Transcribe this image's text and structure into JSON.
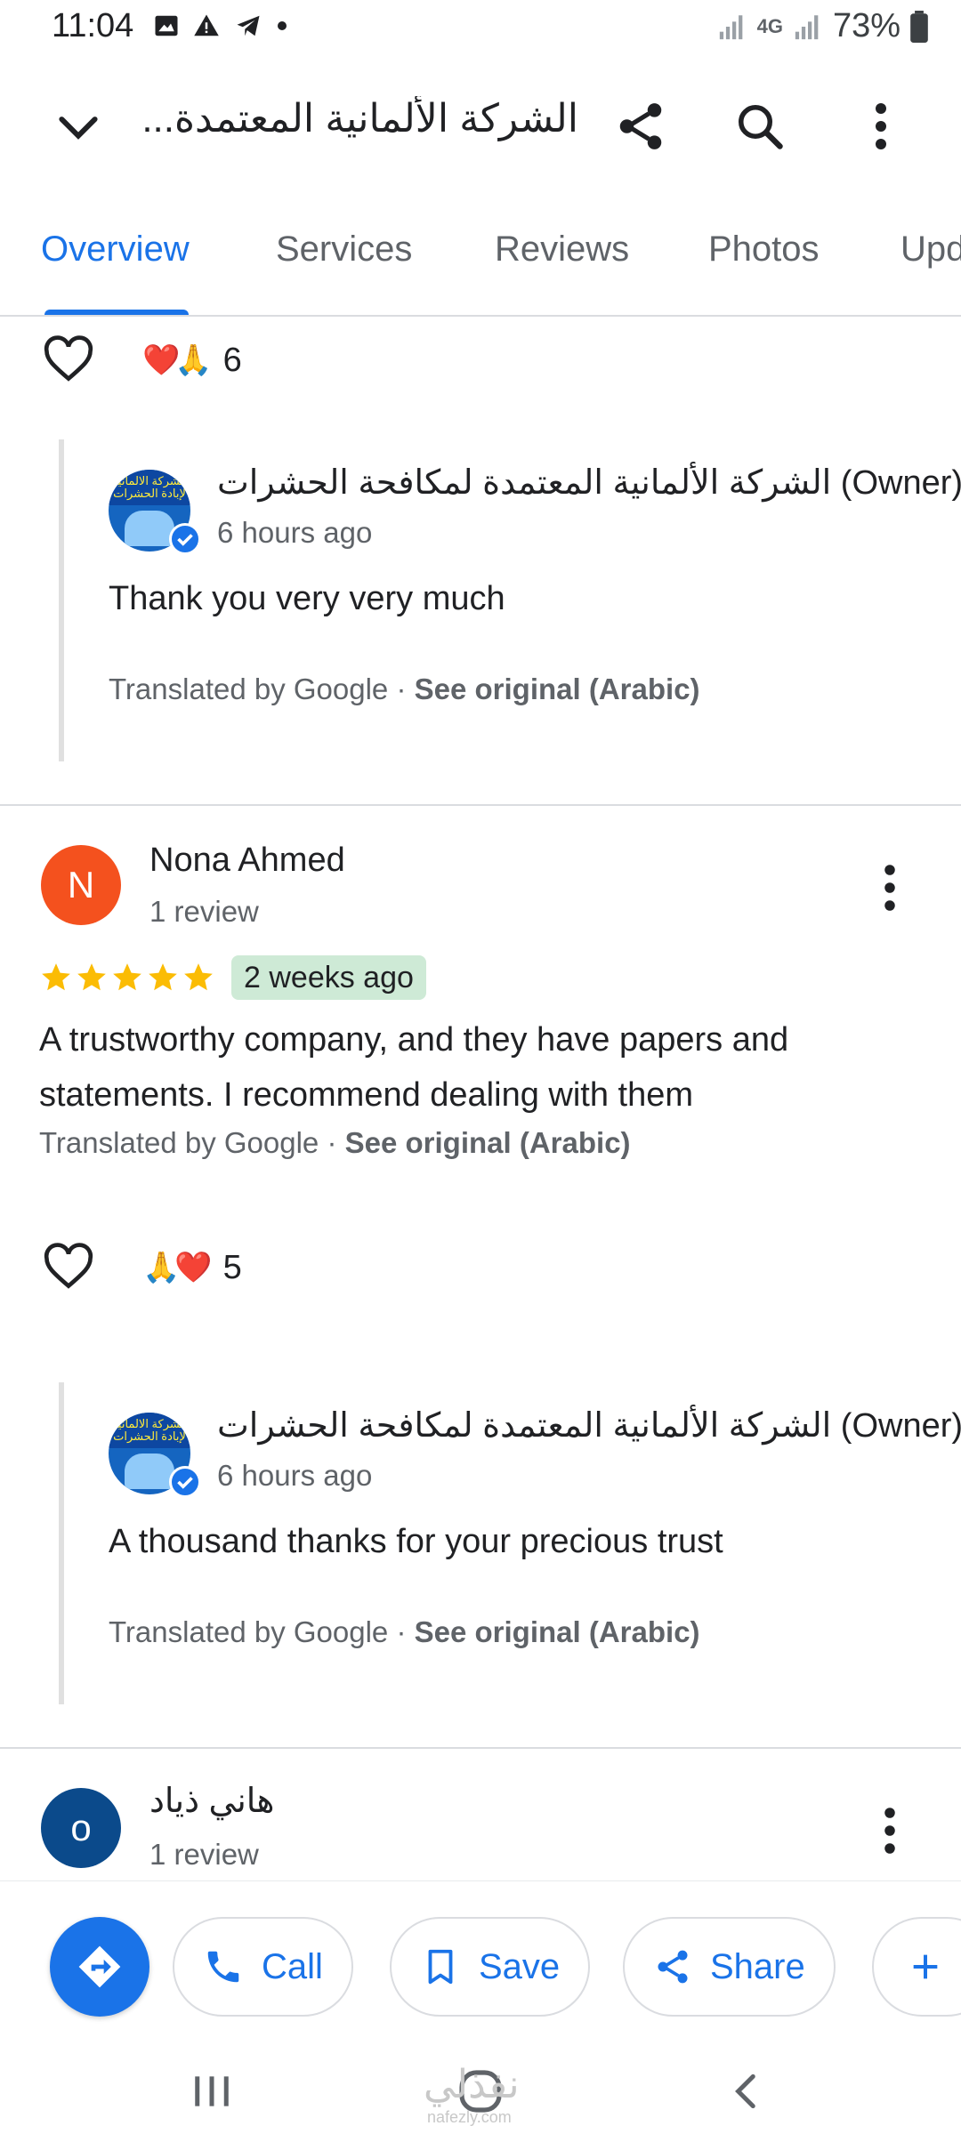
{
  "status_bar": {
    "time": "11:04",
    "battery": "73%",
    "network": "4G"
  },
  "app_bar": {
    "title": "الشركة الألمانية المعتمدة..."
  },
  "tabs": [
    {
      "label": "Overview",
      "active": true
    },
    {
      "label": "Services",
      "active": false
    },
    {
      "label": "Reviews",
      "active": false
    },
    {
      "label": "Photos",
      "active": false
    },
    {
      "label": "Upd",
      "active": false
    }
  ],
  "reviews_feed": {
    "reaction_1": {
      "emojis": "❤️🙏",
      "count": "6"
    },
    "owner_reply_1": {
      "name": "الشركة الألمانية المعتمدة لمكافحة الحشرات (Owner)",
      "time": "6 hours ago",
      "text": "Thank you very very much",
      "translated_prefix": "Translated by Google · ",
      "see_original": "See original (Arabic)"
    },
    "review_1": {
      "avatar_letter": "N",
      "avatar_color": "#f4511e",
      "name": "Nona Ahmed",
      "sub": "1 review",
      "rating": 5,
      "time": "2 weeks ago",
      "text": "A trustworthy company, and they have papers and statements. I recommend dealing with them",
      "translated_prefix": "Translated by Google · ",
      "see_original": "See original (Arabic)"
    },
    "reaction_2": {
      "emojis": "🙏❤️",
      "count": "5"
    },
    "owner_reply_2": {
      "name": "الشركة الألمانية المعتمدة لمكافحة الحشرات (Owner)",
      "time": "6 hours ago",
      "text": "A thousand thanks for your precious trust",
      "translated_prefix": "Translated by Google · ",
      "see_original": "See original (Arabic)"
    },
    "review_2": {
      "avatar_letter": "o",
      "avatar_color": "#0b4a8b",
      "name": "هاني ذياد",
      "sub": "1 review"
    }
  },
  "owner_avatar_text": "الشركة الالمانية لإبادة الحشرات",
  "actions": {
    "call": "Call",
    "save": "Save",
    "share": "Share"
  },
  "watermark": {
    "text": "نفذلي",
    "url": "nafezly.com"
  },
  "colors": {
    "accent": "#1a73e8",
    "star": "#fbbc04",
    "badge_bg": "#ceead6"
  }
}
